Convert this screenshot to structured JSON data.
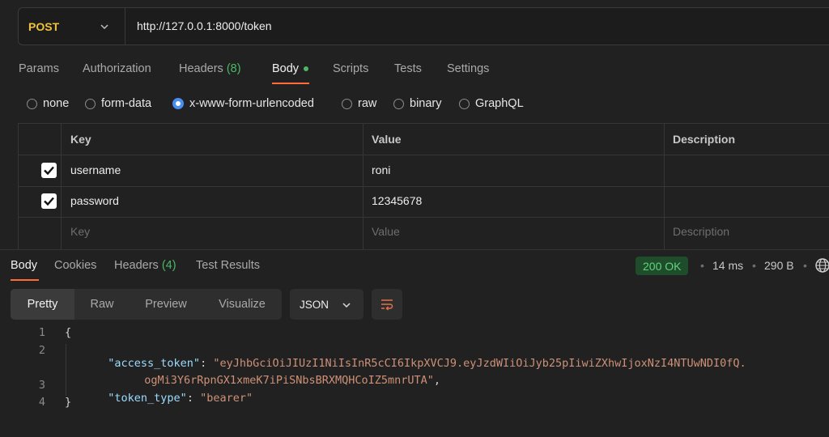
{
  "request": {
    "method": "POST",
    "url": "http://127.0.0.1:8000/token"
  },
  "request_tabs": [
    {
      "label": "Params"
    },
    {
      "label": "Authorization"
    },
    {
      "label": "Headers",
      "count": "(8)"
    },
    {
      "label": "Body",
      "active": true
    },
    {
      "label": "Scripts"
    },
    {
      "label": "Tests"
    },
    {
      "label": "Settings"
    }
  ],
  "body_types": [
    {
      "label": "none"
    },
    {
      "label": "form-data"
    },
    {
      "label": "x-www-form-urlencoded",
      "selected": true
    },
    {
      "label": "raw"
    },
    {
      "label": "binary"
    },
    {
      "label": "GraphQL"
    }
  ],
  "params_table": {
    "headers": [
      "Key",
      "Value",
      "Description"
    ],
    "rows": [
      {
        "checked": true,
        "key": "username",
        "value": "roni",
        "description": ""
      },
      {
        "checked": true,
        "key": "password",
        "value": "12345678",
        "description": ""
      }
    ],
    "placeholder": {
      "key": "Key",
      "value": "Value",
      "description": "Description"
    }
  },
  "response_tabs": [
    {
      "label": "Body",
      "active": true
    },
    {
      "label": "Cookies"
    },
    {
      "label": "Headers",
      "count": "(4)"
    },
    {
      "label": "Test Results"
    }
  ],
  "response_meta": {
    "status": "200 OK",
    "time": "14 ms",
    "size": "290 B",
    "separator": "•"
  },
  "view_modes": [
    "Pretty",
    "Raw",
    "Preview",
    "Visualize"
  ],
  "format": "JSON",
  "code": {
    "line_numbers": [
      "1",
      "2",
      "3",
      "4"
    ],
    "open_brace": "{",
    "close_brace": "}",
    "access_token_key": "\"access_token\"",
    "access_token_value_1": "\"eyJhbGciOiJIUzI1NiIsInR5cCI6IkpXVCJ9.eyJzdWIiOiJyb25pIiwiZXhwIjoxNzI4NTUwNDI0fQ.",
    "access_token_value_2": "ogMi3Y6rRpnGX1xmeK7iPiSNbsBRXMQHCoIZ5mnrUTA\"",
    "token_type_key": "\"token_type\"",
    "token_type_value": "\"bearer\"",
    "colon": ": ",
    "comma": ","
  },
  "colors": {
    "method": "#f0c23a",
    "accent": "#ff6c37",
    "success": "#4bb964",
    "radio_selected": "#4a8cf0",
    "json_key": "#9cdcfe",
    "json_string": "#ce9178"
  }
}
